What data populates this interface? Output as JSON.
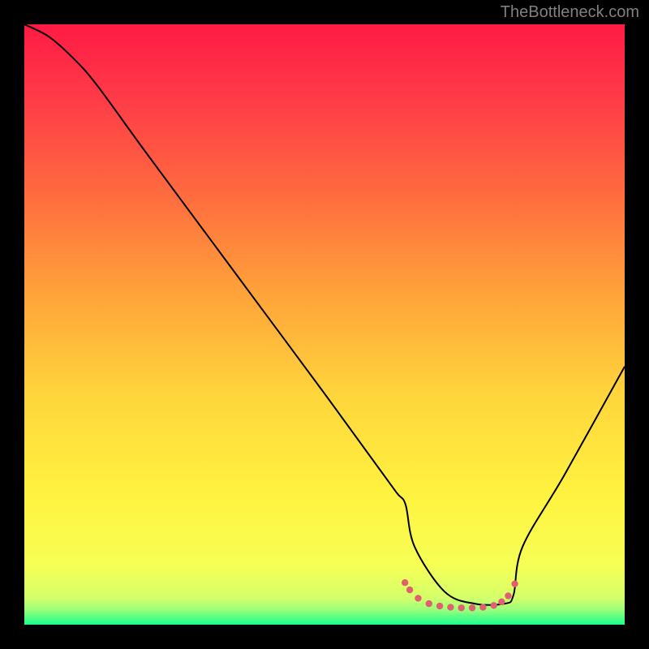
{
  "watermark": "TheBottleneck.com",
  "chart_data": {
    "type": "line",
    "title": "",
    "xlabel": "",
    "ylabel": "",
    "xlim": [
      0,
      100
    ],
    "ylim": [
      0,
      100
    ],
    "grid": false,
    "legend": false,
    "background": {
      "type": "vertical-gradient",
      "stops": [
        {
          "pos": 0.0,
          "color": "#ff1a44"
        },
        {
          "pos": 0.12,
          "color": "#ff3a48"
        },
        {
          "pos": 0.28,
          "color": "#ff6a3f"
        },
        {
          "pos": 0.45,
          "color": "#ffa33a"
        },
        {
          "pos": 0.62,
          "color": "#ffd63c"
        },
        {
          "pos": 0.78,
          "color": "#fff23f"
        },
        {
          "pos": 0.9,
          "color": "#f7ff55"
        },
        {
          "pos": 0.955,
          "color": "#d5ff6a"
        },
        {
          "pos": 0.975,
          "color": "#9cff7a"
        },
        {
          "pos": 0.99,
          "color": "#4cff88"
        },
        {
          "pos": 1.0,
          "color": "#1aff8a"
        }
      ]
    },
    "series": [
      {
        "name": "bottleneck-curve",
        "color": "#000000",
        "stroke_width": 2,
        "x": [
          0,
          4,
          8,
          12,
          20,
          30,
          40,
          50,
          58,
          62,
          63.5,
          65,
          70,
          75,
          80,
          81.5,
          83,
          90,
          100
        ],
        "y": [
          100,
          98,
          94.5,
          90,
          79,
          65.5,
          52,
          38.5,
          27.5,
          22,
          20,
          13,
          5.5,
          3.5,
          3.5,
          5,
          13,
          25,
          43
        ]
      }
    ],
    "markers": [
      {
        "name": "optimal-zone",
        "color": "#e06070",
        "radius": 4.2,
        "points": [
          {
            "x": 63.4,
            "y": 7.0
          },
          {
            "x": 64.2,
            "y": 5.8
          },
          {
            "x": 65.6,
            "y": 4.4
          },
          {
            "x": 67.4,
            "y": 3.5
          },
          {
            "x": 69.2,
            "y": 3.1
          },
          {
            "x": 71.0,
            "y": 2.9
          },
          {
            "x": 72.8,
            "y": 2.8
          },
          {
            "x": 74.6,
            "y": 2.8
          },
          {
            "x": 76.4,
            "y": 2.9
          },
          {
            "x": 78.2,
            "y": 3.2
          },
          {
            "x": 79.5,
            "y": 3.8
          },
          {
            "x": 80.6,
            "y": 4.8
          },
          {
            "x": 81.7,
            "y": 6.8
          }
        ]
      }
    ]
  }
}
